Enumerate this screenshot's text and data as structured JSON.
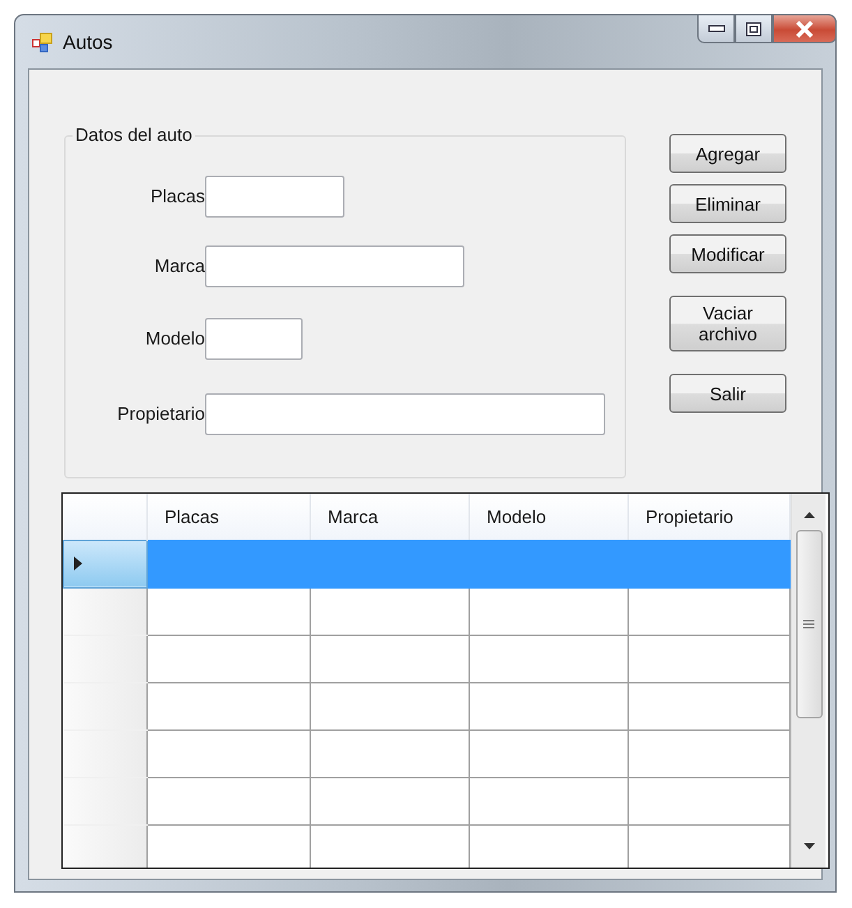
{
  "window": {
    "title": "Autos"
  },
  "group": {
    "title": "Datos del auto",
    "fields": [
      {
        "label": "Placas"
      },
      {
        "label": "Marca"
      },
      {
        "label": "Modelo"
      },
      {
        "label": "Propietario"
      }
    ]
  },
  "buttons": [
    {
      "label": "Agregar"
    },
    {
      "label": "Eliminar"
    },
    {
      "label": "Modificar"
    },
    {
      "label": "Vaciar archivo"
    },
    {
      "label": "Salir"
    }
  ],
  "table": {
    "columns": [
      "Placas",
      "Marca",
      "Modelo",
      "Propietario"
    ],
    "rows": [
      {
        "selected": true
      },
      {
        "selected": false
      },
      {
        "selected": false
      },
      {
        "selected": false
      },
      {
        "selected": false
      },
      {
        "selected": false
      },
      {
        "selected": false
      }
    ]
  }
}
